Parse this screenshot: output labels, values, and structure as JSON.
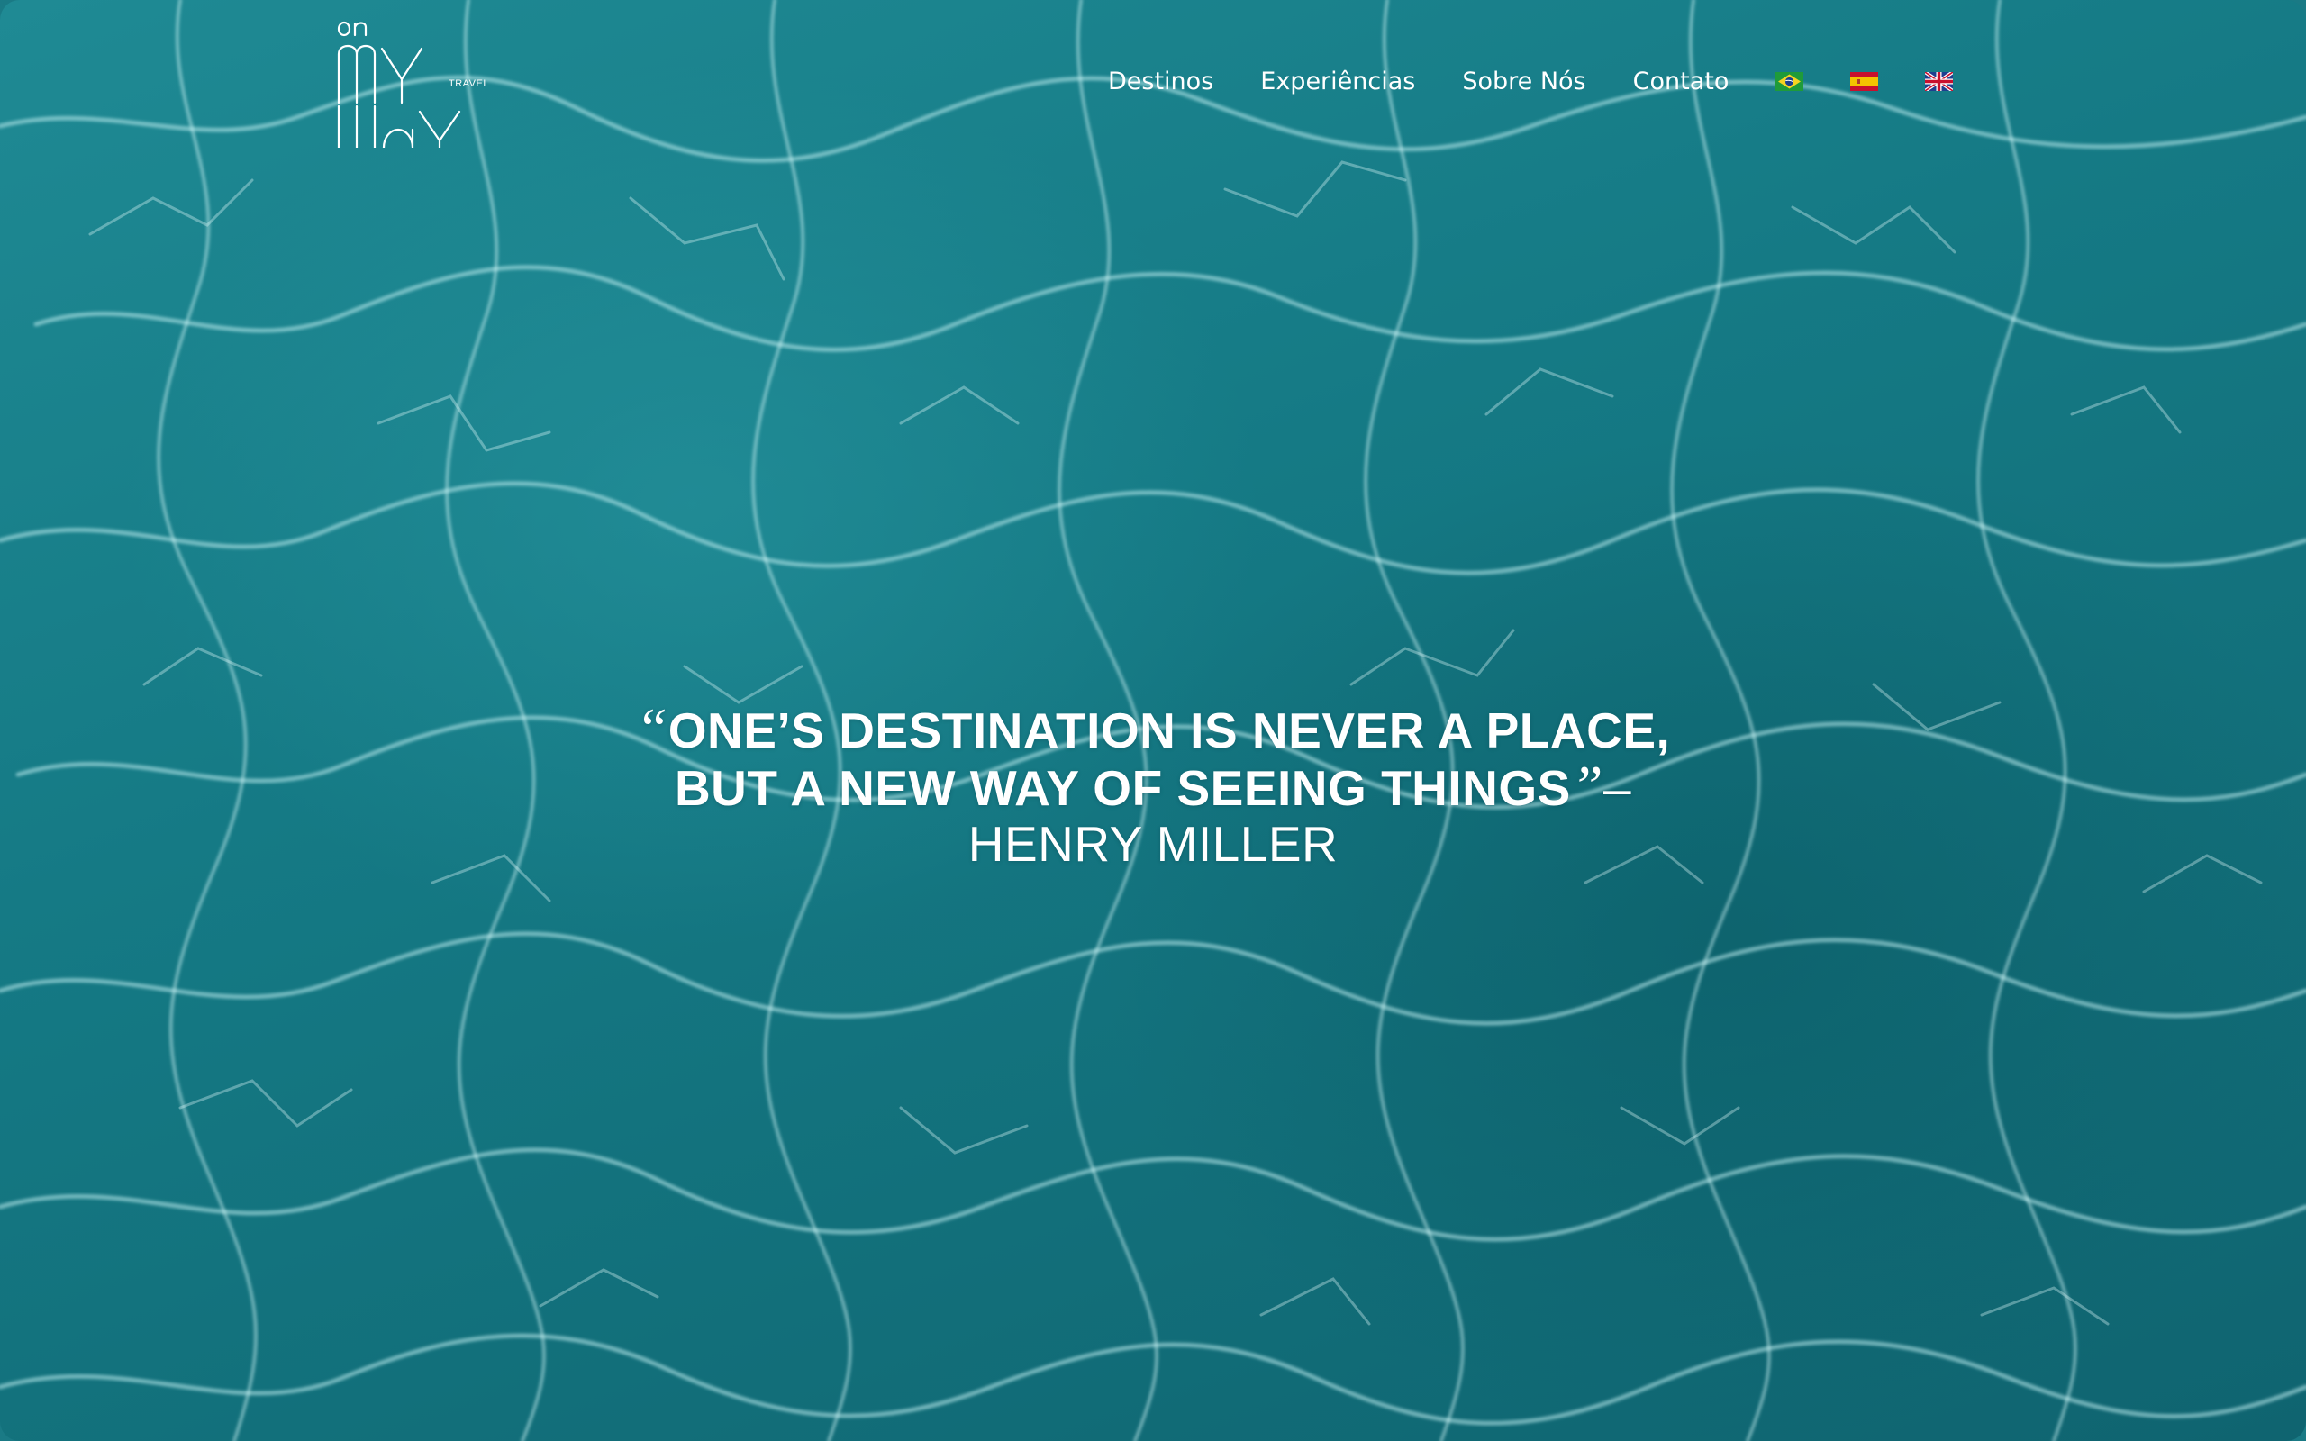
{
  "brand": {
    "logo_small": "on",
    "logo_main_top": "MY",
    "logo_main_bottom": "WAY",
    "logo_sub": "TRAVEL"
  },
  "nav": {
    "items": [
      {
        "label": "Destinos"
      },
      {
        "label": "Experiências"
      },
      {
        "label": "Sobre Nós"
      },
      {
        "label": "Contato"
      }
    ],
    "languages": [
      {
        "icon": "brazil-flag-icon"
      },
      {
        "icon": "spain-flag-icon"
      },
      {
        "icon": "uk-flag-icon"
      }
    ]
  },
  "hero": {
    "open_quote": "“",
    "quote": "ONE’S DESTINATION IS NEVER A PLACE, BUT A NEW WAY OF SEEING THINGS",
    "close_quote": "”",
    "author": "– HENRY MILLER"
  },
  "colors": {
    "water": "#157a85",
    "text": "#ffffff"
  }
}
